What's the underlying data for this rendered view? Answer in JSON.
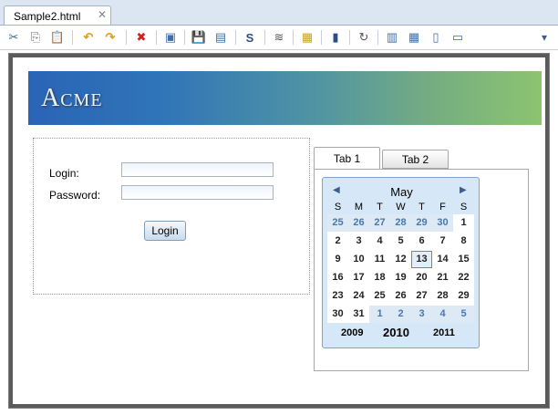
{
  "editor_tab": {
    "title": "Sample2.html",
    "close": "✕"
  },
  "toolbar": {
    "icons": [
      "cut-icon",
      "copy-icon",
      "paste-icon",
      "undo-icon",
      "redo-icon",
      "delete-icon",
      "preview-icon",
      "save-icon",
      "save-all-icon",
      "source-icon",
      "wave-icon",
      "image-icon",
      "device-icon",
      "refresh-icon",
      "layout-icon",
      "split-icon",
      "columns-icon",
      "rows-icon"
    ],
    "glyphs": [
      "✂",
      "⎘",
      "📋",
      "↶",
      "↷",
      "✖",
      "▣",
      "💾",
      "▤",
      "S",
      "≋",
      "▦",
      "▮",
      "↻",
      "▥",
      "▦",
      "▯",
      "▭"
    ],
    "menu": "▾"
  },
  "banner": {
    "logo": "Acme"
  },
  "login": {
    "login_label": "Login:",
    "password_label": "Password:",
    "login_value": "",
    "password_value": "",
    "button": "Login"
  },
  "tabs": [
    {
      "label": "Tab 1"
    },
    {
      "label": "Tab 2"
    }
  ],
  "calendar": {
    "month": "May",
    "prev": "◀",
    "next": "▶",
    "weekdays": [
      "S",
      "M",
      "T",
      "W",
      "T",
      "F",
      "S"
    ],
    "weeks": [
      [
        "25",
        "26",
        "27",
        "28",
        "29",
        "30",
        "1"
      ],
      [
        "2",
        "3",
        "4",
        "5",
        "6",
        "7",
        "8"
      ],
      [
        "9",
        "10",
        "11",
        "12",
        "13",
        "14",
        "15"
      ],
      [
        "16",
        "17",
        "18",
        "19",
        "20",
        "21",
        "22"
      ],
      [
        "23",
        "24",
        "25",
        "26",
        "27",
        "28",
        "29"
      ],
      [
        "30",
        "31",
        "1",
        "2",
        "3",
        "4",
        "5"
      ]
    ],
    "other_month_flags": [
      [
        true,
        true,
        true,
        true,
        true,
        true,
        false
      ],
      [
        false,
        false,
        false,
        false,
        false,
        false,
        false
      ],
      [
        false,
        false,
        false,
        false,
        false,
        false,
        false
      ],
      [
        false,
        false,
        false,
        false,
        false,
        false,
        false
      ],
      [
        false,
        false,
        false,
        false,
        false,
        false,
        false
      ],
      [
        false,
        false,
        true,
        true,
        true,
        true,
        true
      ]
    ],
    "selected_day": "13",
    "prev_year": "2009",
    "current_year": "2010",
    "next_year": "2011"
  }
}
